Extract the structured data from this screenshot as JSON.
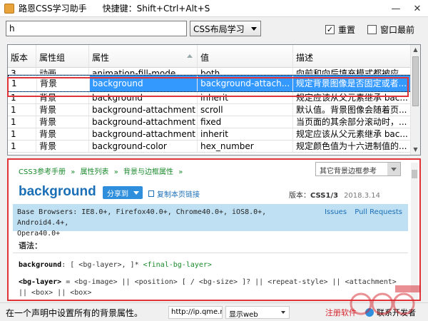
{
  "window": {
    "title": "路恩CSS学习助手",
    "hotkey": "快捷键：Shift+Ctrl+Alt+S",
    "min_glyph": "—",
    "close_glyph": "✕"
  },
  "search": {
    "value": "h",
    "category": "CSS布局学习"
  },
  "options": {
    "reset_label": "重置",
    "reset_checked": true,
    "topmost_label": "窗口最前",
    "topmost_checked": false,
    "check_glyph": "✓"
  },
  "table": {
    "headers": [
      "版本",
      "属性组",
      "属性",
      "值",
      "描述"
    ],
    "rows": [
      [
        "3",
        "动画",
        "animation-fill-mode",
        "both",
        "向前和向后填充模式都被应..."
      ],
      [
        "1",
        "背景",
        "background",
        "background-attach...",
        "规定背景图像是否固定或者..."
      ],
      [
        "1",
        "背景",
        "background",
        "inherit",
        "规定应该从父元素继承 bac..."
      ],
      [
        "1",
        "背景",
        "background-attachment",
        "scroll",
        "默认值。背景图像会随着页..."
      ],
      [
        "1",
        "背景",
        "background-attachment",
        "fixed",
        "当页面的其余部分滚动时，..."
      ],
      [
        "1",
        "背景",
        "background-attachment",
        "inherit",
        "规定应该从父元素继承 bac..."
      ],
      [
        "1",
        "背景",
        "background-color",
        "hex_number",
        "规定颜色值为十六进制值的..."
      ]
    ],
    "scroll_up": "▲",
    "scroll_down": "▼"
  },
  "doc": {
    "breadcrumb": [
      "CSS3参考手册",
      "»",
      "属性列表",
      "»",
      "背景与边框属性",
      "»"
    ],
    "other_ref": "其它背景边框参考",
    "title": "background",
    "share": "分享到",
    "copy_link": "复制本页链接",
    "version_label": "版本：",
    "version_value": "CSS1/3",
    "date": "2018.3.14",
    "compat_line1": "Base Browsers: IE8.0+, Firefox40.0+, Chrome40.0+, iOS8.0+, Android4.4+,",
    "compat_line2": "Opera40.0+",
    "issues": "Issues",
    "pull_requests": "Pull Requests",
    "syntax_label": "语法：",
    "syntax1_key": "background",
    "syntax1_rest": ": [ <bg-layer>, ]* ",
    "syntax1_final": "<final-bg-layer>",
    "syntax2_key": "<bg-layer>",
    "syntax2_rest": " = <bg-image> || <position> [ / <bg-size> ]? || <repeat-style> || <attachment> || <box> || <box>"
  },
  "status": {
    "description": "在一个声明中设置所有的背景属性。",
    "url": "http://ip.qme.na",
    "show_mode": "显示web",
    "register": "注册软件",
    "contact": "联系开发者"
  },
  "colors": {
    "accent": "#3399ff",
    "highlight_border": "#e0343b",
    "title_blue": "#1a6fb6",
    "breadcrumb_green": "#1a8a2c"
  }
}
